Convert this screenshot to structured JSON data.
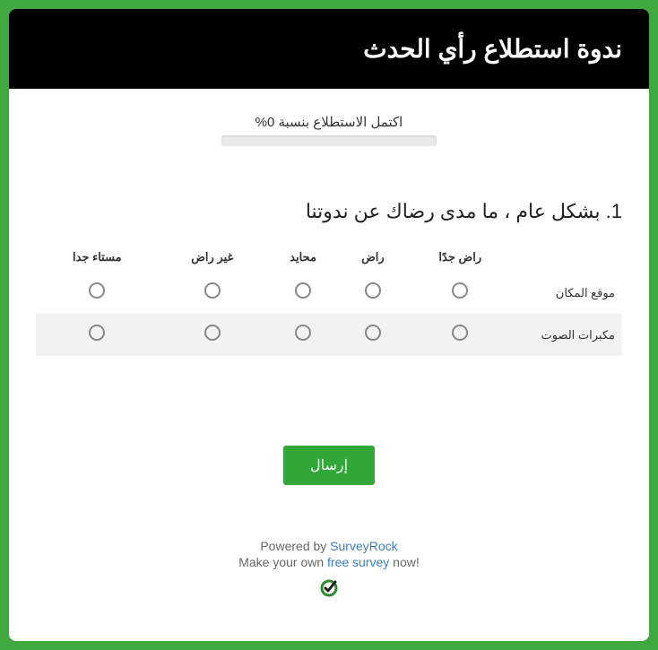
{
  "header": {
    "title": "ندوة استطلاع رأي الحدث"
  },
  "progress": {
    "label": "اكتمل الاستطلاع بنسبة 0%"
  },
  "question": {
    "number": "1",
    "text": "بشكل عام ، ما مدى رضاك عن ندوتنا",
    "full": "1. بشكل عام ، ما مدى رضاك عن ندوتنا",
    "columns": [
      "راض جدًا",
      "راض",
      "محايد",
      "غير راض",
      "مستاء جدا"
    ],
    "rows": [
      "موقع المكان",
      "مكبرات الصوت"
    ]
  },
  "submit": {
    "label": "إرسال"
  },
  "footer": {
    "powered_prefix": "Powered by ",
    "powered_link": "SurveyRock",
    "make_prefix": "Make your own ",
    "make_link": "free survey",
    "make_suffix": " now!"
  }
}
